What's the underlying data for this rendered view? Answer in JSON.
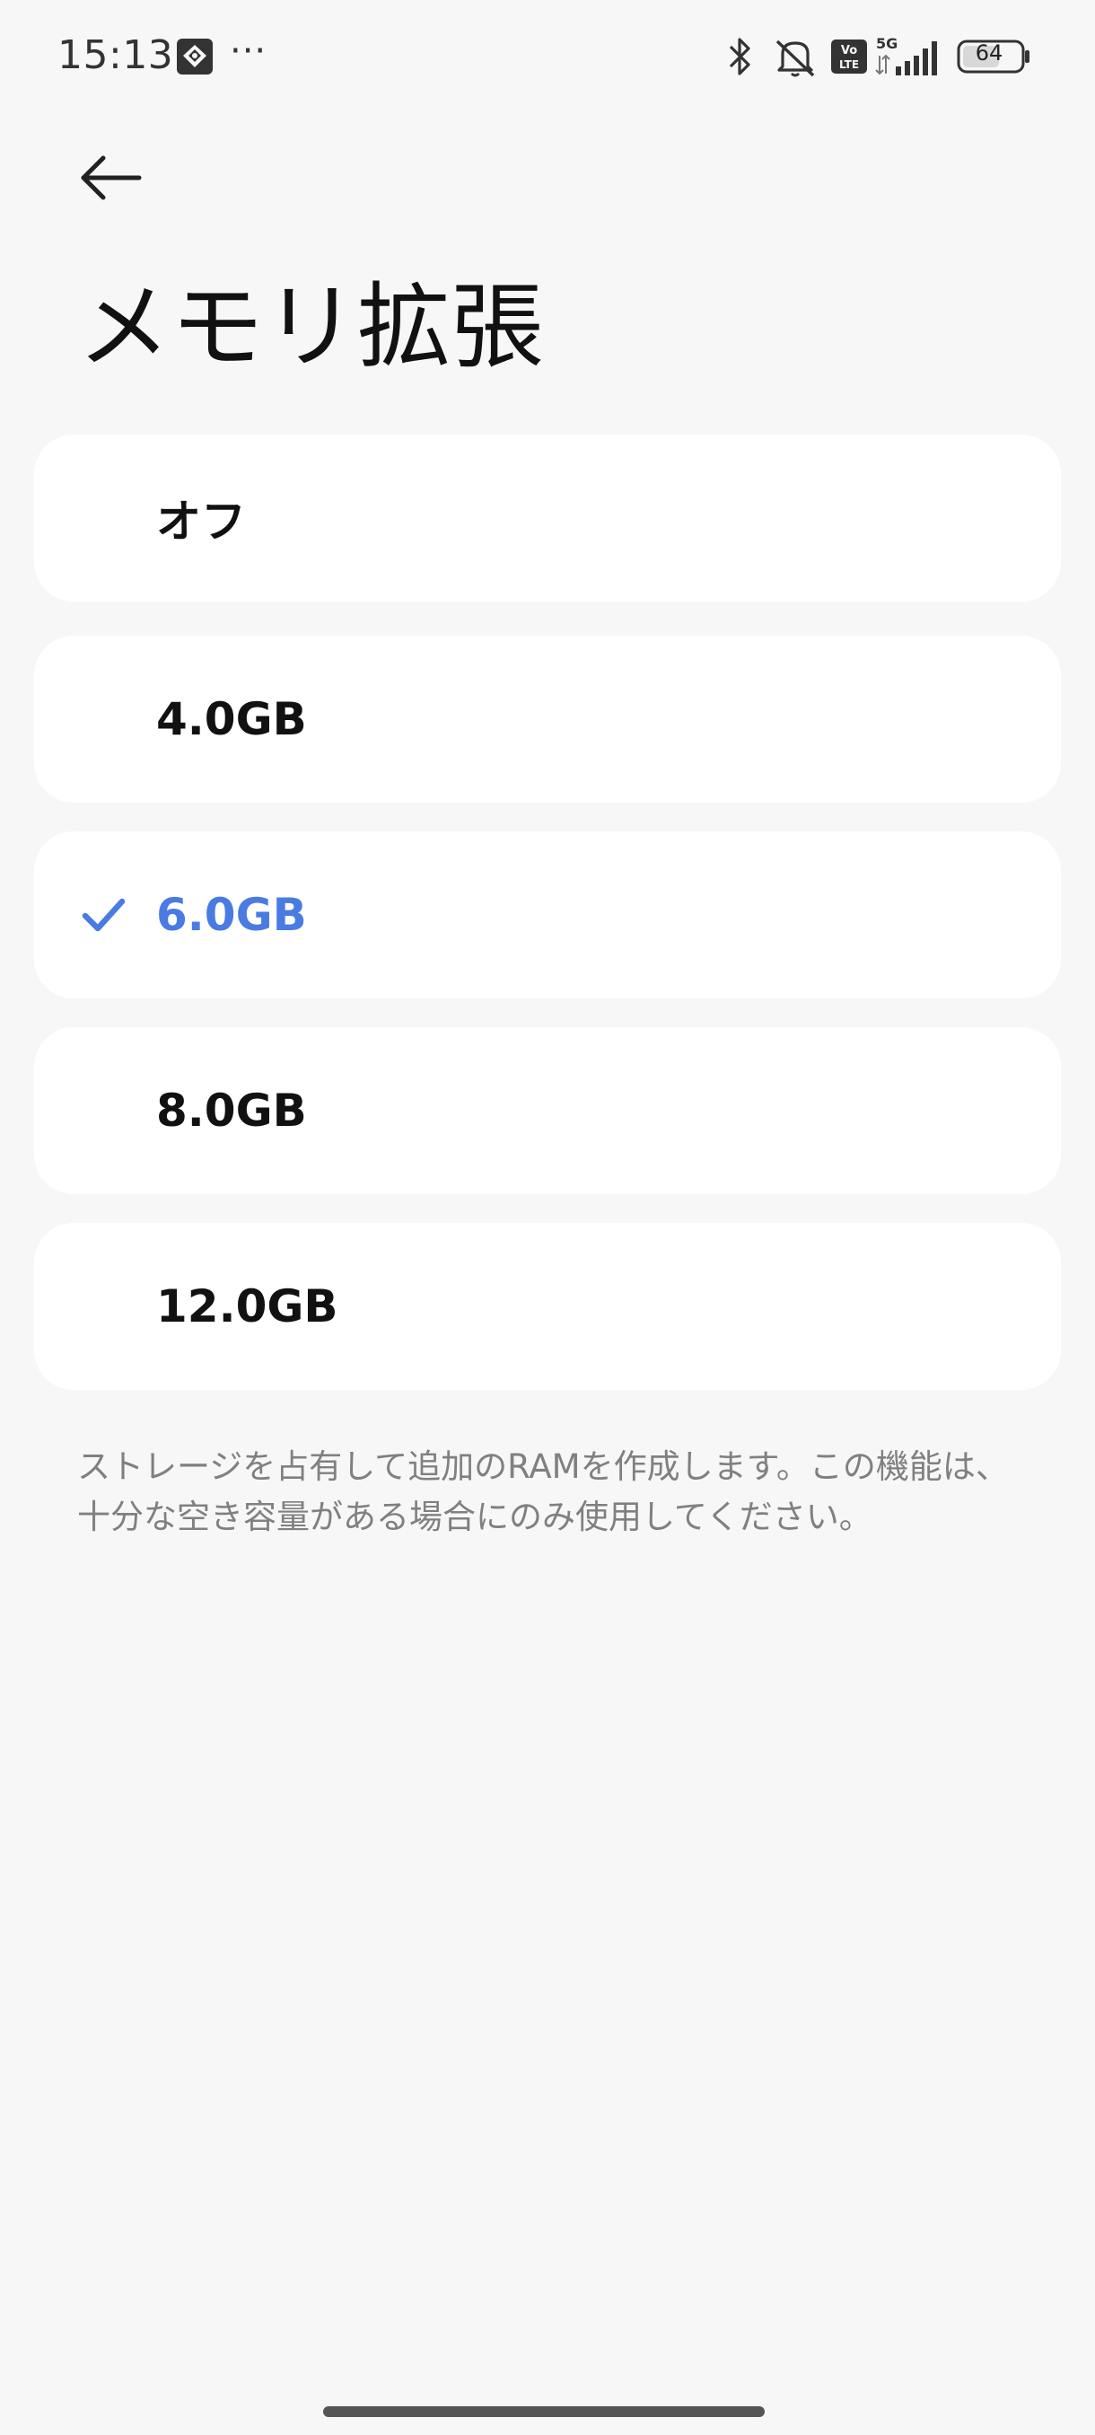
{
  "status_bar": {
    "time": "15:13",
    "more": "···",
    "battery_level": "64",
    "network": "5G",
    "volte": "Vo LTE"
  },
  "header": {
    "back_icon": "arrow-left-icon",
    "title": "メモリ拡張"
  },
  "options": [
    {
      "label": "オフ",
      "selected": false
    },
    {
      "label": "4.0GB",
      "selected": false
    },
    {
      "label": "6.0GB",
      "selected": true
    },
    {
      "label": "8.0GB",
      "selected": false
    },
    {
      "label": "12.0GB",
      "selected": false
    }
  ],
  "description": "ストレージを占有して追加のRAMを作成します。この機能は、十分な空き容量がある場合にのみ使用してください。",
  "colors": {
    "background": "#f7f7f7",
    "card": "#ffffff",
    "accent": "#4a7be3",
    "secondary_text": "#808080"
  }
}
